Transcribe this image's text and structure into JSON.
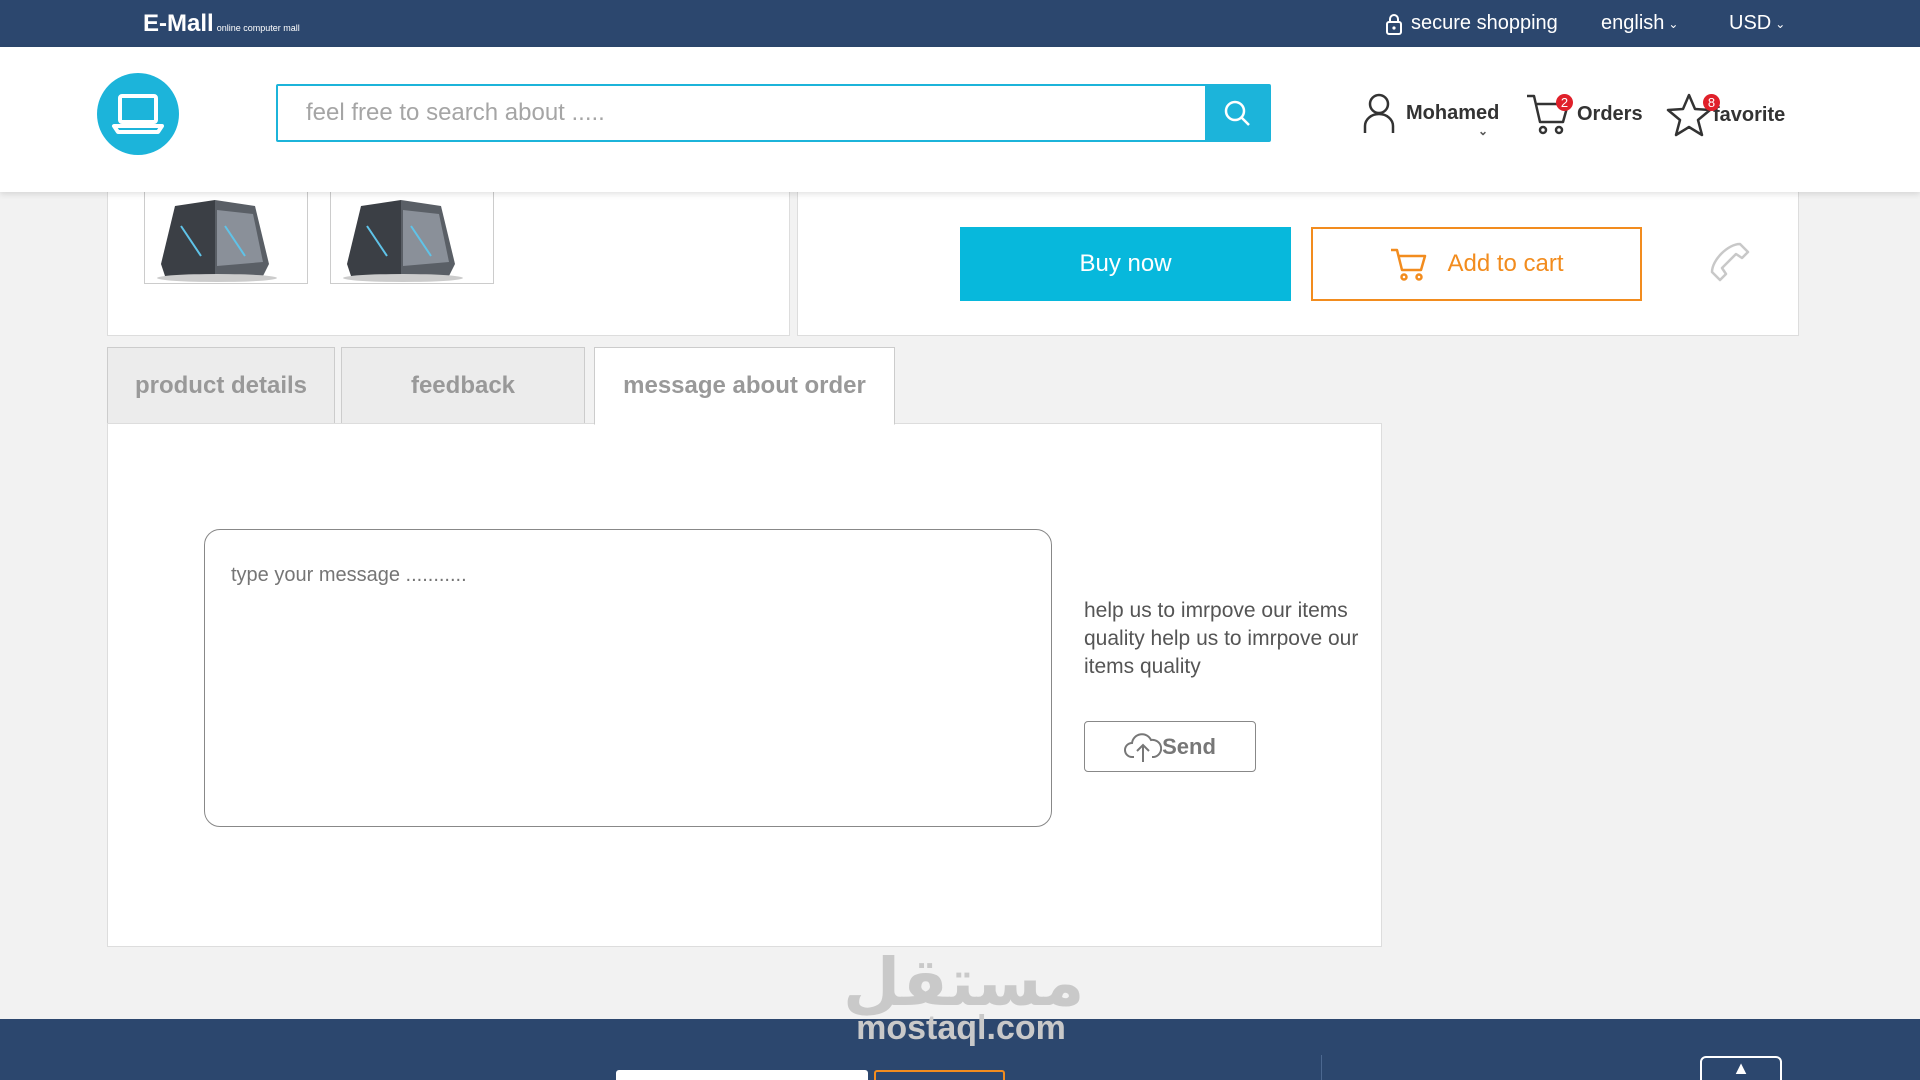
{
  "topbar": {
    "brand": "E-Mall",
    "brand_sub": "online computer mall",
    "secure": "secure shopping",
    "language": "english",
    "currency": "USD"
  },
  "header": {
    "search_placeholder": "feel free to search about .....",
    "user_name": "Mohamed",
    "orders_label": "Orders",
    "orders_count": "2",
    "favorite_label": "favorite",
    "favorite_count": "8"
  },
  "product": {
    "buy_label": "Buy now",
    "cart_label": "Add to cart"
  },
  "tabs": [
    {
      "label": "product details"
    },
    {
      "label": "feedback"
    },
    {
      "label": "message about order"
    }
  ],
  "message": {
    "placeholder": "type your message ...........",
    "help_text": "help us to imrpove our items quality help us to imrpove our items quality",
    "send_label": "Send"
  },
  "watermark": {
    "arabic": "مستقل",
    "latin": "mostaql.com"
  },
  "colors": {
    "navy": "#2c476e",
    "accent": "#1cb4da",
    "orange": "#f28c1e",
    "badge": "#e0202a"
  }
}
